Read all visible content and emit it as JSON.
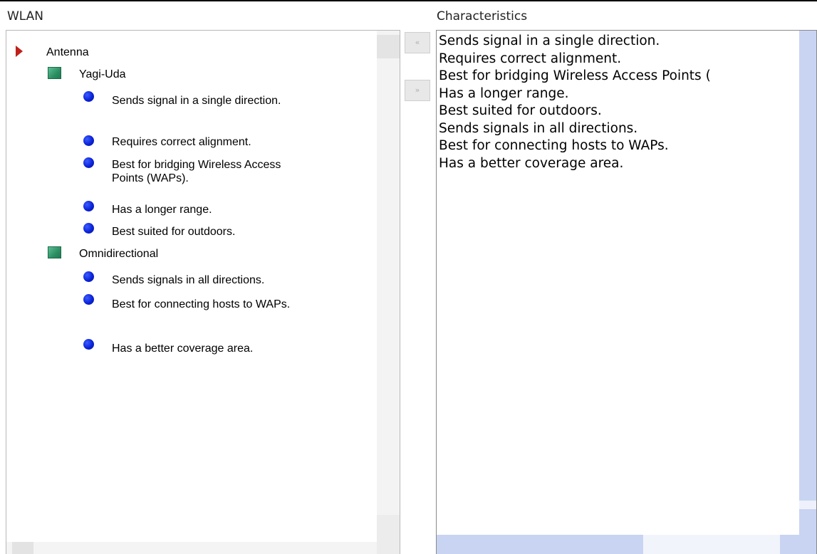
{
  "left_pane": {
    "title": "WLAN",
    "tree": {
      "root": "Antenna",
      "groups": [
        {
          "label": "Yagi-Uda",
          "items": [
            "Sends signal in a single direction.",
            "Requires correct alignment.",
            "Best for bridging Wireless Access Points (WAPs).",
            "Has a longer range.",
            "Best suited for outdoors."
          ]
        },
        {
          "label": "Omnidirectional",
          "items": [
            "Sends signals in all directions.",
            "Best for connecting hosts to WAPs.",
            "Has a better coverage area."
          ]
        }
      ]
    }
  },
  "buttons": {
    "move_left": "«",
    "move_right": "»"
  },
  "right_pane": {
    "title": "Characteristics",
    "items": [
      "Sends signal in a single direction.",
      "Requires correct alignment.",
      "Best for bridging Wireless Access Points (",
      "Has a longer range.",
      "Best suited for outdoors.",
      "Sends signals in all directions.",
      "Best for connecting hosts to WAPs.",
      "Has a better coverage area."
    ]
  },
  "icons": {
    "root": "red-triangle-arrow-icon",
    "group": "green-square-icon",
    "item": "blue-dot-icon"
  },
  "colors": {
    "root_arrow": "#c0201a",
    "group_square": "#2a8f62",
    "item_dot": "#0a22d8",
    "right_scrollbar": "#c9d4f3"
  }
}
